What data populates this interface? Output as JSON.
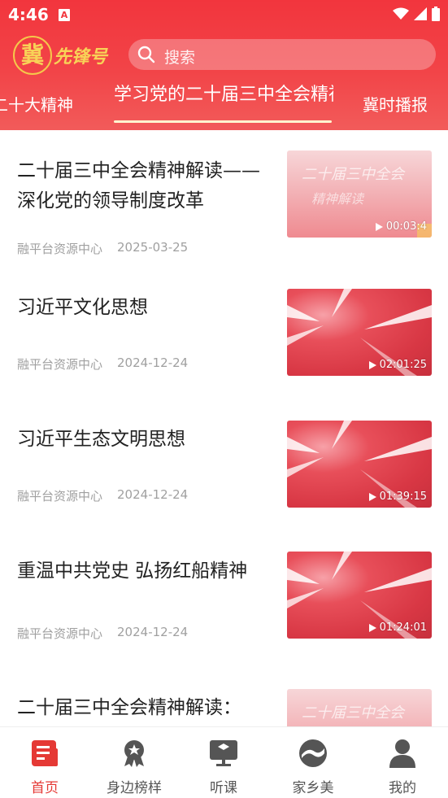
{
  "status_bar": {
    "time": "4:46",
    "app_badge": "A"
  },
  "header": {
    "logo_seal_char": "冀",
    "logo_script": "先锋号",
    "search_placeholder": "搜索"
  },
  "tabs": [
    {
      "label": "二十大精神"
    },
    {
      "label": "学习党的二十届三中全会精神",
      "active": true
    },
    {
      "label": "冀时播报"
    }
  ],
  "feed": [
    {
      "title": "二十届三中全会精神解读——深化党的领导制度改革",
      "source": "融平台资源中心",
      "date": "2025-03-25",
      "duration": "00:03:4"
    },
    {
      "title": "习近平文化思想",
      "source": "融平台资源中心",
      "date": "2024-12-24",
      "duration": "02:01:25"
    },
    {
      "title": "习近平生态文明思想",
      "source": "融平台资源中心",
      "date": "2024-12-24",
      "duration": "01:39:15"
    },
    {
      "title": "重温中共党史 弘扬红船精神",
      "source": "融平台资源中心",
      "date": "2024-12-24",
      "duration": "01:24:01"
    },
    {
      "title": "二十届三中全会精神解读：",
      "source": "",
      "date": "",
      "duration": ""
    }
  ],
  "bottom_nav": [
    {
      "label": "首页",
      "icon": "home-news-icon",
      "active": true
    },
    {
      "label": "身边榜样",
      "icon": "badge-star-icon"
    },
    {
      "label": "听课",
      "icon": "lecture-icon"
    },
    {
      "label": "家乡美",
      "icon": "landscape-icon"
    },
    {
      "label": "我的",
      "icon": "user-icon"
    }
  ],
  "colors": {
    "primary": "#f2353d",
    "active_nav": "#e53935",
    "icon_gray": "#555555"
  }
}
